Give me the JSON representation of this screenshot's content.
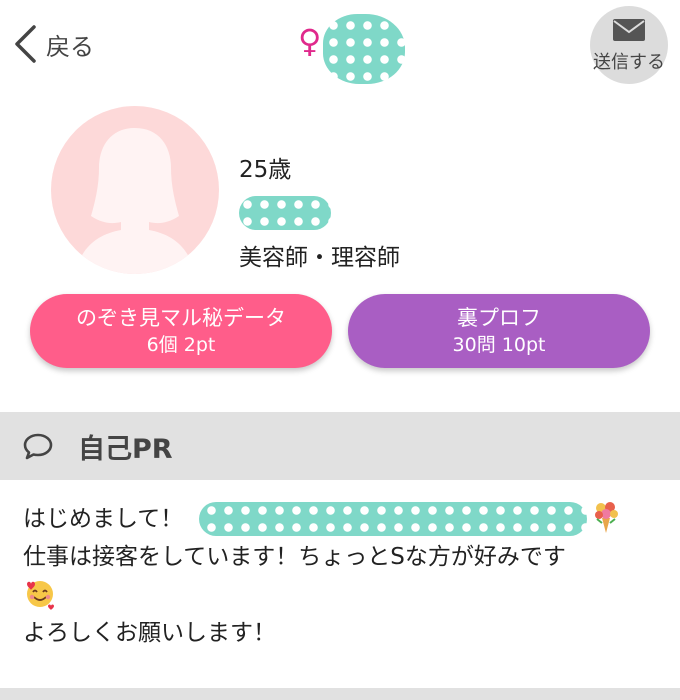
{
  "header": {
    "back_label": "戻る",
    "gender_symbol": "♀",
    "send_label": "送信する"
  },
  "profile": {
    "age": "25歳",
    "occupation": "美容師・理容師"
  },
  "buttons": {
    "peek": {
      "title": "のぞき見マル秘データ",
      "sub": "6個 2pt"
    },
    "ura": {
      "title": "裏プロフ",
      "sub": "30問 10pt"
    }
  },
  "section": {
    "title": "自己PR"
  },
  "pr": {
    "line1_start": "はじめまして！",
    "line2": "仕事は接客をしています！ちょっとSな方が好みです",
    "line4": "よろしくお願いします！"
  },
  "icons": {
    "back": "chevron-left-icon",
    "send": "envelope-icon",
    "section": "speech-bubble-icon",
    "bouquet": "bouquet-emoji",
    "face": "smiling-face-with-hearts-emoji"
  },
  "colors": {
    "gender": "#e0298c",
    "peek_button": "#ff5d8a",
    "ura_button": "#a95ec3",
    "section_bar": "#e1e1e1",
    "mask": "#7fd8c8",
    "avatar_bg": "#fdd9d9"
  }
}
